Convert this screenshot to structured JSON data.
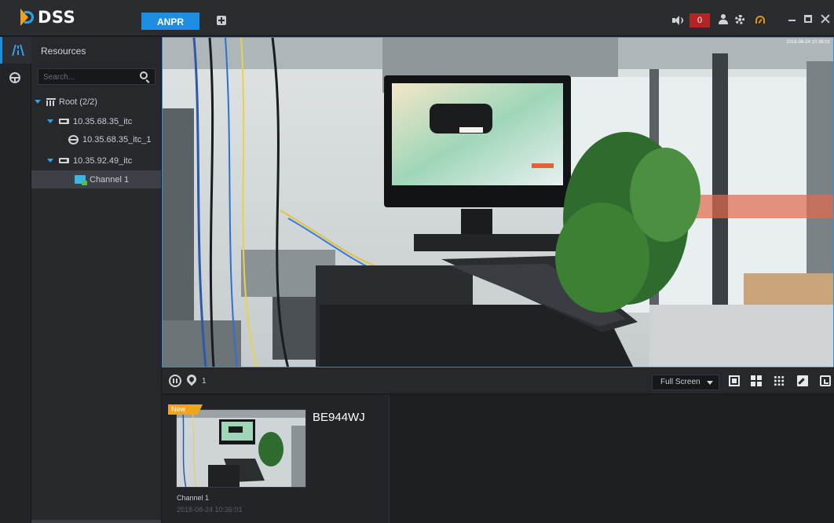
{
  "app": {
    "logo_text": "DSS",
    "active_tab": "ANPR",
    "alarm_count": "0",
    "accent_color": "#1e8fe0"
  },
  "sidebar": {
    "rail_icons": [
      "resource-icon",
      "steering-wheel-icon"
    ]
  },
  "resources": {
    "title": "Resources",
    "search_placeholder": "Search...",
    "tree": [
      {
        "label": "Root (2/2)",
        "icon": "org-icon",
        "level": 0,
        "expanded": true
      },
      {
        "label": "10.35.68.35_itc",
        "icon": "device-icon",
        "level": 1,
        "expanded": true
      },
      {
        "label": "10.35.68.35_itc_1",
        "icon": "itc-icon",
        "level": 2
      },
      {
        "label": "10.35.92.49_itc",
        "icon": "device-icon",
        "level": 1,
        "expanded": true
      },
      {
        "label": "Channel 1",
        "icon": "channel-icon",
        "level": 2,
        "selected": true
      }
    ]
  },
  "video": {
    "timestamp": "2018-08-24 10:36:01"
  },
  "controls": {
    "pin_count": "1",
    "fullscreen_label": "Full Screen",
    "layout_icons": [
      "layout-1-icon",
      "layout-4-icon",
      "layout-9-icon",
      "edit-icon",
      "exit-icon"
    ]
  },
  "record": {
    "badge": "New",
    "plate": "BE944WJ",
    "channel": "Channel 1",
    "time": "2018-08-24 10:36:01"
  }
}
